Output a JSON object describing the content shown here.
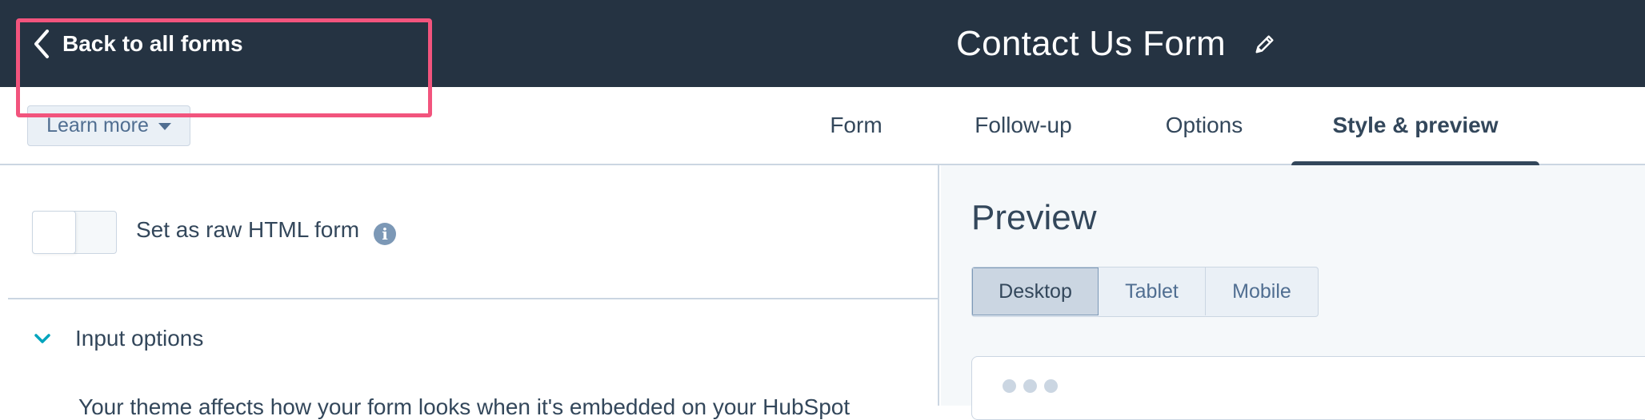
{
  "header": {
    "back_label": "Back to all forms",
    "form_title": "Contact Us Form",
    "edit_icon": "pencil-icon"
  },
  "toolbar": {
    "learn_more_label": "Learn more",
    "tabs": [
      {
        "label": "Form",
        "active": false
      },
      {
        "label": "Follow-up",
        "active": false
      },
      {
        "label": "Options",
        "active": false
      },
      {
        "label": "Style & preview",
        "active": true
      }
    ]
  },
  "settings": {
    "raw_html_label": "Set as raw HTML form",
    "raw_html_enabled": false,
    "info_icon": "info-icon",
    "highlight_color": "#f2547d",
    "input_options_label": "Input options",
    "body_text_partial": "Your theme affects how your form looks when it's embedded on your HubSpot"
  },
  "preview": {
    "title": "Preview",
    "devices": [
      {
        "label": "Desktop",
        "active": true
      },
      {
        "label": "Tablet",
        "active": false
      },
      {
        "label": "Mobile",
        "active": false
      }
    ]
  },
  "colors": {
    "header_bg": "#253342",
    "text": "#33475b",
    "accent": "#33475b",
    "border": "#cbd6e2",
    "teal": "#00a4bd"
  }
}
